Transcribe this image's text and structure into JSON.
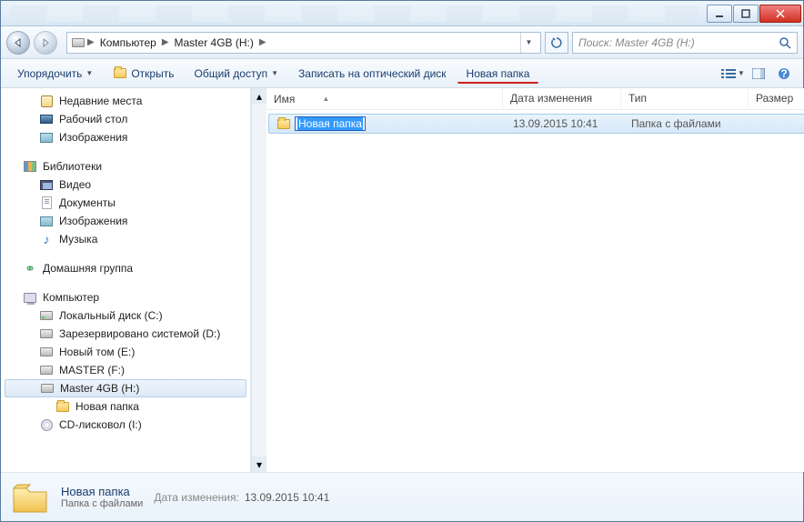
{
  "breadcrumbs": {
    "root_icon": "computer",
    "items": [
      "Компьютер",
      "Master 4GB (H:)"
    ]
  },
  "search": {
    "placeholder": "Поиск: Master 4GB (H:)"
  },
  "toolbar": {
    "organize": "Упорядочить",
    "open": "Открыть",
    "share": "Общий доступ",
    "burn": "Записать на оптический диск",
    "new_folder": "Новая папка"
  },
  "columns": {
    "name": "Имя",
    "date": "Дата изменения",
    "type": "Тип",
    "size": "Размер"
  },
  "files": [
    {
      "name": "Новая папка",
      "date": "13.09.2015 10:41",
      "type": "Папка с файлами",
      "renaming": true
    }
  ],
  "sidebar": {
    "quick": [
      {
        "label": "Недавние места",
        "icon": "recent"
      },
      {
        "label": "Рабочий стол",
        "icon": "desktop"
      },
      {
        "label": "Изображения",
        "icon": "images"
      }
    ],
    "libraries_label": "Библиотеки",
    "libraries": [
      {
        "label": "Видео",
        "icon": "video"
      },
      {
        "label": "Документы",
        "icon": "doc"
      },
      {
        "label": "Изображения",
        "icon": "images"
      },
      {
        "label": "Музыка",
        "icon": "music"
      }
    ],
    "homegroup_label": "Домашняя группа",
    "computer_label": "Компьютер",
    "drives": [
      {
        "label": "Локальный диск (C:)",
        "icon": "hdd"
      },
      {
        "label": "Зарезервировано системой (D:)",
        "icon": "drive"
      },
      {
        "label": "Новый том (E:)",
        "icon": "drive"
      },
      {
        "label": "MASTER (F:)",
        "icon": "drive"
      },
      {
        "label": "Master 4GB (H:)",
        "icon": "drive",
        "selected": true,
        "children": [
          {
            "label": "Новая папка",
            "icon": "folder"
          }
        ]
      },
      {
        "label": "CD-лисковол (I:)",
        "icon": "cd"
      }
    ]
  },
  "details": {
    "name": "Новая папка",
    "type": "Папка с файлами",
    "date_label": "Дата изменения:",
    "date": "13.09.2015 10:41"
  }
}
